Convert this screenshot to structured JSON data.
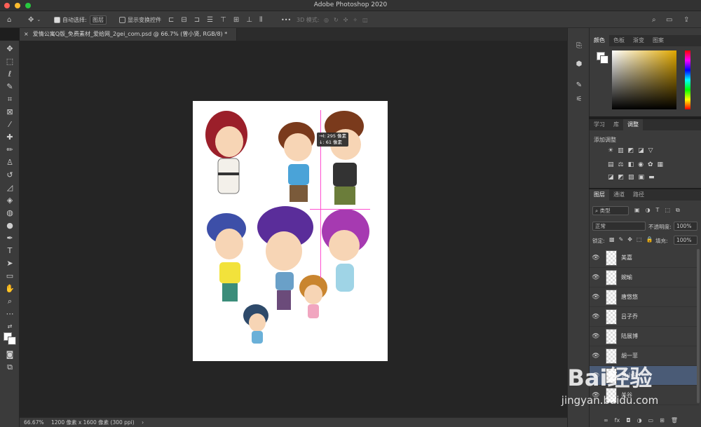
{
  "window": {
    "title": "Adobe Photoshop 2020",
    "buttons": [
      "#ff5f57",
      "#febc2e",
      "#28c840"
    ]
  },
  "options_bar": {
    "auto_select_label": "自动选择:",
    "auto_select_value": "图层",
    "show_transform_label": "显示变换控件",
    "mode_3d_label": "3D 模式:",
    "more": "•••"
  },
  "document": {
    "tab_title": "爱情公寓Q版_免费素材_爱给网_2gei_com.psd @ 66.7% (曾小贤, RGB/8) *",
    "tooltip_line1": "→I: 295 像素",
    "tooltip_line2": "↓: 61 像素"
  },
  "status": {
    "zoom": "66.67%",
    "info": "1200 像素 x 1600 像素 (300 ppi)",
    "arrow": "›"
  },
  "panels": {
    "color_tabs": [
      "颜色",
      "色板",
      "渐变",
      "图案"
    ],
    "learn_tabs": [
      "学习",
      "库",
      "调整"
    ],
    "adjust_title": "添加调整",
    "layer_tabs": [
      "图层",
      "通道",
      "路径"
    ],
    "filter_kind": "类型",
    "blend_mode": "正常",
    "opacity_label": "不透明度:",
    "opacity_value": "100%",
    "lock_label": "锁定:",
    "fill_label": "填充:",
    "fill_value": "100%",
    "layers": [
      "美嘉",
      "婉瑜",
      "唐悠悠",
      "吕子乔",
      "陆展博",
      "胡一菲",
      "曾小贤",
      "关谷"
    ]
  },
  "watermark": {
    "brand": "Bai经验",
    "url": "jingyan.baidu.com"
  },
  "colors": {
    "guide": "#ff4fd1",
    "selected_layer": "#4a5b76",
    "accent": "#2d6fd6"
  }
}
